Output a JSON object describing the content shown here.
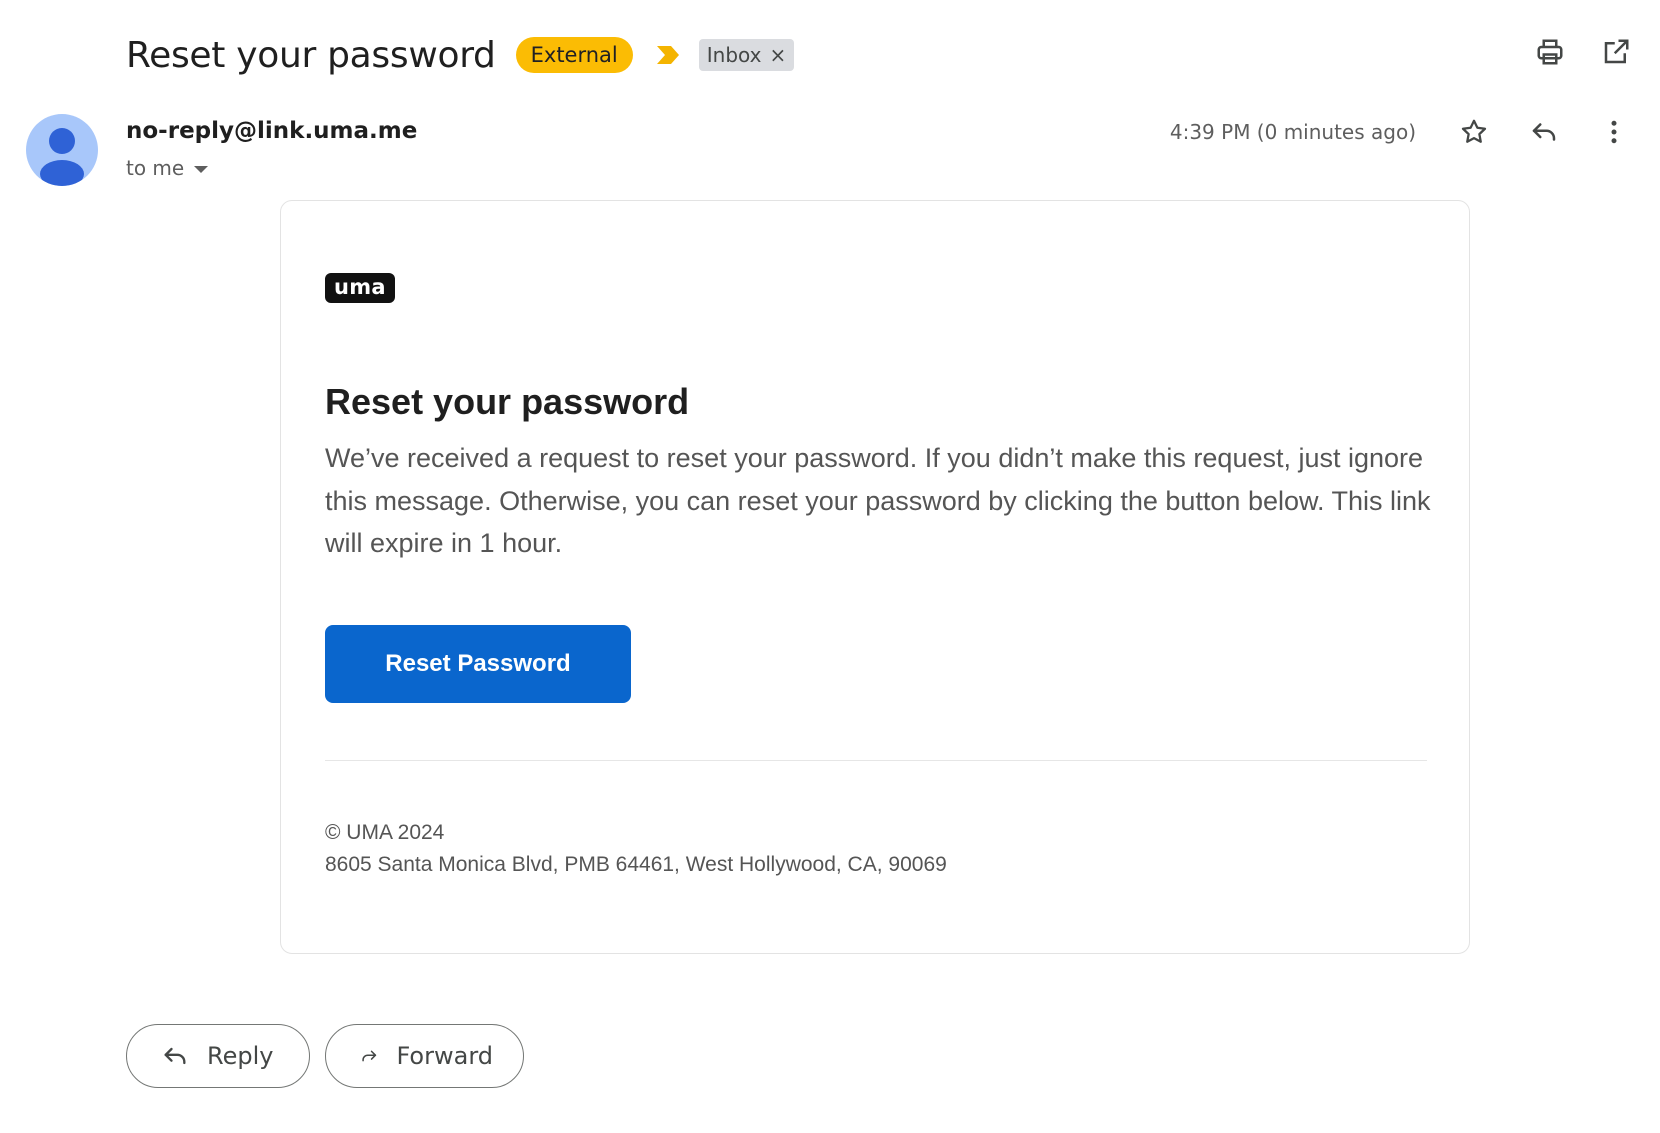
{
  "subject": "Reset your password",
  "badges": {
    "external": "External",
    "inbox": "Inbox",
    "inbox_remove": "×"
  },
  "top_actions": {
    "print_icon": "printer-icon",
    "open_icon": "open-in-new-window-icon"
  },
  "sender": {
    "email": "no-reply@link.uma.me",
    "to_label": "to me",
    "timestamp": "4:39 PM (0 minutes ago)"
  },
  "email": {
    "logo": "uma",
    "title": "Reset your password",
    "body": "We’ve received a request to reset your password. If you didn’t make this request, just ignore this message. Otherwise, you can reset your password by clicking the button below. This link will expire in 1 hour.",
    "button_label": "Reset Password",
    "footer_copyright": "© UMA 2024",
    "footer_address": "8605 Santa Monica Blvd, PMB 64461, West Hollywood, CA, 90069"
  },
  "bottom_actions": {
    "reply": "Reply",
    "forward": "Forward"
  },
  "colors": {
    "external_badge": "#fbbc04",
    "reset_button": "#0a66cd",
    "avatar": "#a8c7fa"
  }
}
